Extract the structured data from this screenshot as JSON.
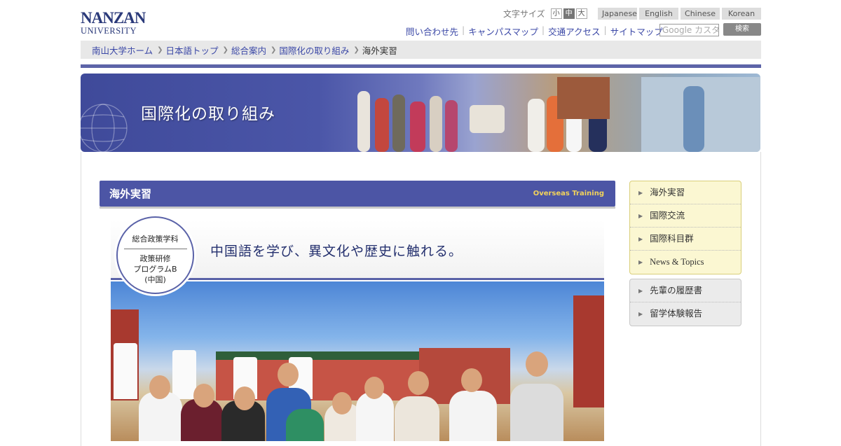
{
  "logo": {
    "line1": "NANZAN",
    "line2": "UNIVERSITY"
  },
  "fontsize": {
    "label": "文字サイズ",
    "small": "小",
    "medium": "中",
    "large": "大"
  },
  "languages": [
    "Japanese",
    "English",
    "Chinese",
    "Korean"
  ],
  "utility_links": [
    "問い合わせ先",
    "キャンパスマップ",
    "交通アクセス",
    "サイトマップ"
  ],
  "search": {
    "placeholder": "Google カスタム検索",
    "button": "検索"
  },
  "breadcrumb": {
    "links": [
      "南山大学ホーム",
      "日本語トップ",
      "総合案内",
      "国際化の取り組み"
    ],
    "current": "海外実習"
  },
  "banner": {
    "title": "国際化の取り組み"
  },
  "section": {
    "title": "海外実習",
    "title_en": "Overseas Training"
  },
  "feature": {
    "department": "総合政策学科",
    "program_line1": "政策研修",
    "program_line2": "プログラムB",
    "program_line3": "(中国)",
    "catchphrase": "中国語を学び、異文化や歴史に触れる。"
  },
  "sidebar": {
    "primary": [
      "海外実習",
      "国際交流",
      "国際科目群",
      "News & Topics"
    ],
    "secondary": [
      "先輩の履歴書",
      "留学体験報告"
    ]
  },
  "colors": {
    "accent": "#4c55a5",
    "link": "#3a47a6",
    "english_title": "#f2d35a"
  }
}
